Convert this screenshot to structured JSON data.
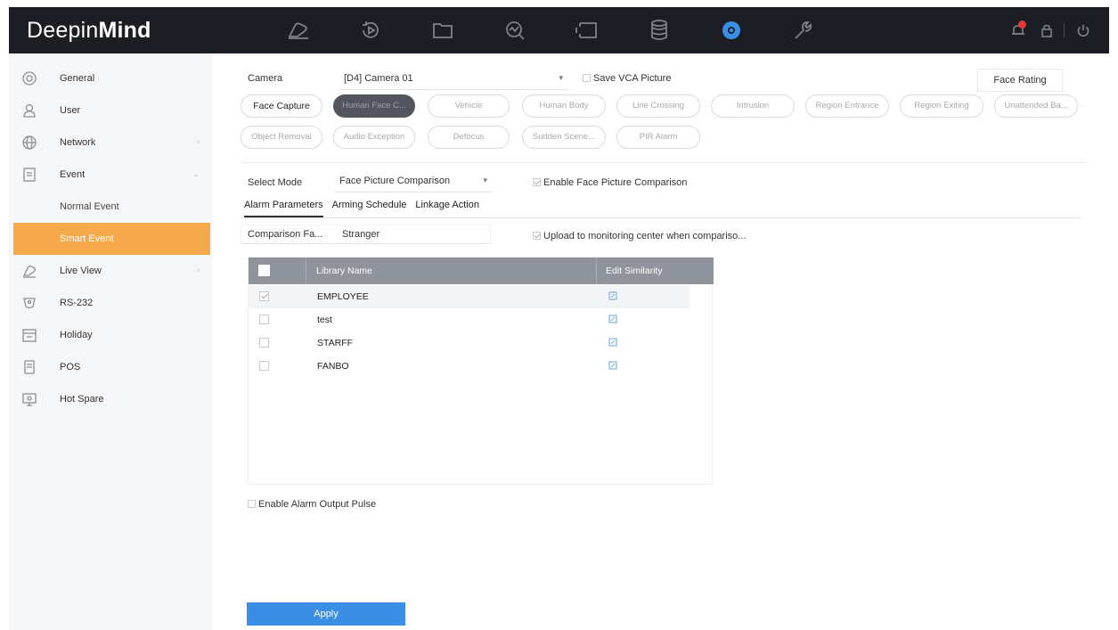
{
  "brand": {
    "name_light": "Deepin",
    "name_bold": "Mind"
  },
  "topnav": {
    "icons": [
      "live-view-icon",
      "playback-icon",
      "file-management-icon",
      "smart-analysis-icon",
      "display-icon",
      "storage-icon",
      "configuration-icon",
      "maintenance-icon"
    ],
    "active": "configuration-icon",
    "accent": "#3a8ee6"
  },
  "topright": {
    "icons": [
      "alarm-bell-icon",
      "lock-icon",
      "power-icon"
    ],
    "alert_color": "#e53935"
  },
  "sidebar": {
    "items": [
      {
        "icon": "general-icon",
        "label": "General"
      },
      {
        "icon": "user-icon",
        "label": "User"
      },
      {
        "icon": "network-icon",
        "label": "Network"
      },
      {
        "icon": "event-icon",
        "label": "Event"
      },
      {
        "icon": "live-view-icon",
        "label": "Live View"
      },
      {
        "icon": "rs232-icon",
        "label": "RS-232"
      },
      {
        "icon": "holiday-icon",
        "label": "Holiday"
      },
      {
        "icon": "pos-icon",
        "label": "POS"
      },
      {
        "icon": "hot-spare-icon",
        "label": "Hot Spare"
      }
    ],
    "event_sub": [
      "Normal Event",
      "Smart Event"
    ],
    "active_color": "#f6a94a"
  },
  "camera": {
    "label": "Camera",
    "value": "[D4] Camera 01"
  },
  "save_vca": "Save VCA Picture",
  "face_rating": "Face Rating",
  "event_types": [
    "Face Capture",
    "Human Face C...",
    "Vehicle",
    "Human Body",
    "Line Crossing",
    "Intrusion",
    "Region Entrance",
    "Region Exiting",
    "Unattended Ba...",
    "Object Removal",
    "Audio Exception",
    "Defocus",
    "Sudden Scene...",
    "PIR Alarm"
  ],
  "select_mode": {
    "label": "Select Mode",
    "value": "Face Picture Comparison"
  },
  "enable_comparison": "Enable Face Picture Comparison",
  "tabs": [
    "Alarm Parameters",
    "Arming Schedule",
    "Linkage Action"
  ],
  "comparison": {
    "label": "Comparison Fa...",
    "value": "Stranger"
  },
  "upload": "Upload to monitoring center when compariso...",
  "table": {
    "headers": [
      "Library Name",
      "Edit Similarity"
    ],
    "rows": [
      {
        "name": "EMPLOYEE",
        "checked": true
      },
      {
        "name": "test",
        "checked": false
      },
      {
        "name": "STARFF",
        "checked": false
      },
      {
        "name": "FANBO",
        "checked": false
      }
    ]
  },
  "alarm_pulse": "Enable Alarm Output Pulse",
  "apply": "Apply"
}
